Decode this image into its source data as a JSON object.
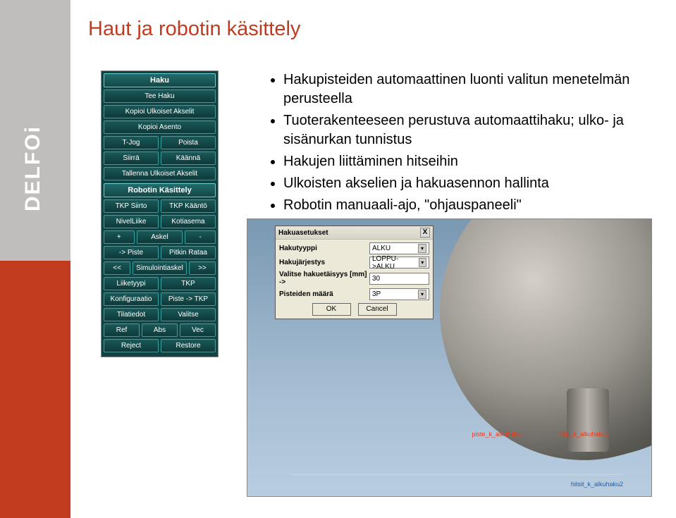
{
  "brand": "DELFOi",
  "title": "Haut ja robotin käsittely",
  "bullets": [
    "Hakupisteiden automaattinen luonti valitun menetelmän perusteella",
    "Tuoterakenteeseen perustuva automaattihaku; ulko- ja sisänurkan tunnistus",
    "Hakujen liittäminen hitseihin",
    "Ulkoisten akselien ja hakuasennon hallinta",
    "Robotin manuaali-ajo, \"ohjauspaneeli\""
  ],
  "panel": {
    "haku_header": "Haku",
    "tee_haku": "Tee Haku",
    "kopioi_ulk": "Kopioi Ulkoiset Akselit",
    "kopioi_asento": "Kopioi Asento",
    "tjog": "T-Jog",
    "poista": "Poista",
    "siirra": "Siirrä",
    "kaanna": "Käännä",
    "tallenna_ulk": "Tallenna Ulkoiset Akselit",
    "robot_header": "Robotin Käsittely",
    "tkp_siirto": "TKP Siirto",
    "tkp_kaanto": "TKP Kääntö",
    "nivelliike": "NivelLiike",
    "kotiasema": "Kotiasema",
    "plus": "+",
    "askel": "Askel",
    "minus": "-",
    "to_piste": "-> Piste",
    "pitkin_rataa": "Pitkin Rataa",
    "back": "<<",
    "simulointiaskel": "Simulointiaskel",
    "fwd": ">>",
    "liiketyypi": "Liiketyypi",
    "tkp": "TKP",
    "konfiguraatio": "Konfiguraatio",
    "piste_tkp": "Piste -> TKP",
    "tilatiedot": "Tilatiedot",
    "valitse": "Valitse",
    "ref": "Ref",
    "abs": "Abs",
    "vec": "Vec",
    "reject": "Reject",
    "restore": "Restore"
  },
  "dialog": {
    "title": "Hakuasetukset",
    "close": "X",
    "row1_label": "Hakutyyppi",
    "row1_value": "ALKU",
    "row2_label": "Hakujärjestys",
    "row2_value": "LOPPU->ALKU",
    "row3_label": "Valitse hakuetäisyys [mm] ->",
    "row3_value": "30",
    "row4_label": "Pisteiden määrä",
    "row4_value": "3P",
    "ok": "OK",
    "cancel": "Cancel"
  },
  "simlabels": {
    "l1": "hku_k_alkuhaku1",
    "l2": "piste_k_alkuhaku",
    "l3": "hitsit_k_alkuhaku2"
  }
}
